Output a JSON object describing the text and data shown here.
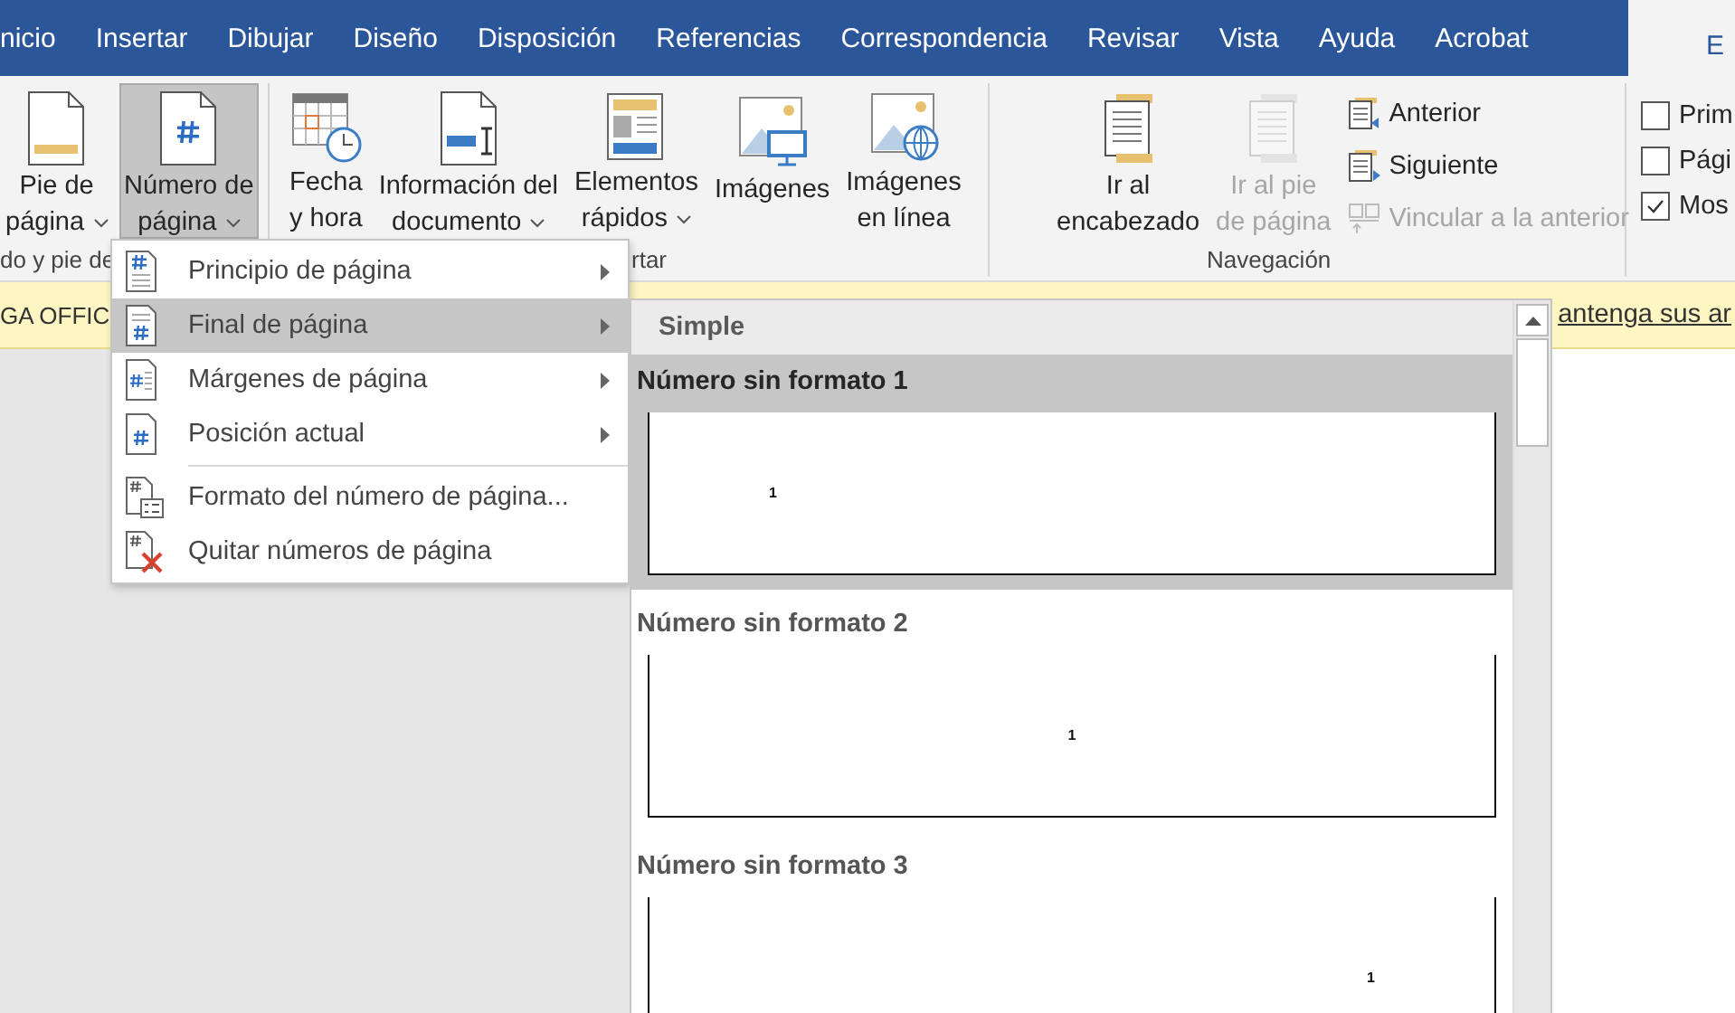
{
  "tabs": [
    {
      "label": "nicio",
      "selected": false
    },
    {
      "label": "Insertar",
      "selected": false
    },
    {
      "label": "Dibujar",
      "selected": false
    },
    {
      "label": "Diseño",
      "selected": false
    },
    {
      "label": "Disposición",
      "selected": false
    },
    {
      "label": "Referencias",
      "selected": false
    },
    {
      "label": "Correspondencia",
      "selected": false
    },
    {
      "label": "Revisar",
      "selected": false
    },
    {
      "label": "Vista",
      "selected": false
    },
    {
      "label": "Ayuda",
      "selected": false
    },
    {
      "label": "Acrobat",
      "selected": false
    },
    {
      "label": "E",
      "selected": true
    }
  ],
  "ribbon": {
    "groups": [
      {
        "label": "do y pie de",
        "large_buttons": [
          {
            "lines": [
              "Pie de",
              "página"
            ],
            "dropdown": true,
            "pressed": false,
            "disabled": false
          },
          {
            "lines": [
              "Número de",
              "página"
            ],
            "dropdown": true,
            "pressed": true,
            "disabled": false
          }
        ]
      },
      {
        "label": "rtar",
        "large_buttons": [
          {
            "lines": [
              "Fecha",
              "y hora"
            ],
            "dropdown": false,
            "pressed": false,
            "disabled": false
          },
          {
            "lines": [
              "Información del",
              "documento"
            ],
            "dropdown": true,
            "pressed": false,
            "disabled": false
          },
          {
            "lines": [
              "Elementos",
              "rápidos"
            ],
            "dropdown": true,
            "pressed": false,
            "disabled": false
          },
          {
            "lines": [
              "Imágenes"
            ],
            "dropdown": false,
            "pressed": false,
            "disabled": false
          },
          {
            "lines": [
              "Imágenes",
              "en línea"
            ],
            "dropdown": false,
            "pressed": false,
            "disabled": false
          }
        ]
      },
      {
        "label": "Navegación",
        "large_buttons": [
          {
            "lines": [
              "Ir al",
              "encabezado"
            ],
            "dropdown": false,
            "pressed": false,
            "disabled": false
          },
          {
            "lines": [
              "Ir al pie",
              "de página"
            ],
            "dropdown": false,
            "pressed": false,
            "disabled": true
          }
        ],
        "small_buttons": [
          {
            "label": "Anterior",
            "disabled": false
          },
          {
            "label": "Siguiente",
            "disabled": false
          },
          {
            "label": "Vincular a la anterior",
            "disabled": true
          }
        ]
      },
      {
        "checkboxes": [
          {
            "label": "Prim",
            "checked": false
          },
          {
            "label": "Pági",
            "checked": false
          },
          {
            "label": "Mos",
            "checked": true
          }
        ]
      }
    ]
  },
  "notice_bar": {
    "left_text": "GA OFFIC",
    "link_text": "antenga sus ar"
  },
  "menu": {
    "sections": [
      {
        "items": [
          {
            "label": "Principio de página",
            "submenu": true,
            "selected": false
          },
          {
            "label": "Final de página",
            "submenu": true,
            "selected": true
          },
          {
            "label": "Márgenes de página",
            "submenu": true,
            "selected": false
          },
          {
            "label": "Posición actual",
            "submenu": true,
            "selected": false
          }
        ]
      },
      {
        "items": [
          {
            "label": "Formato del número de página...",
            "submenu": false,
            "selected": false
          },
          {
            "label": "Quitar números de página",
            "submenu": false,
            "selected": false
          }
        ]
      }
    ]
  },
  "gallery": {
    "header": "Simple",
    "items": [
      {
        "title": "Número sin formato 1",
        "selected": true,
        "number": "1",
        "kind": "left"
      },
      {
        "title": "Número sin formato 2",
        "selected": false,
        "number": "1",
        "kind": "center"
      },
      {
        "title": "Número sin formato 3",
        "selected": false,
        "number": "1",
        "kind": "right"
      }
    ]
  }
}
